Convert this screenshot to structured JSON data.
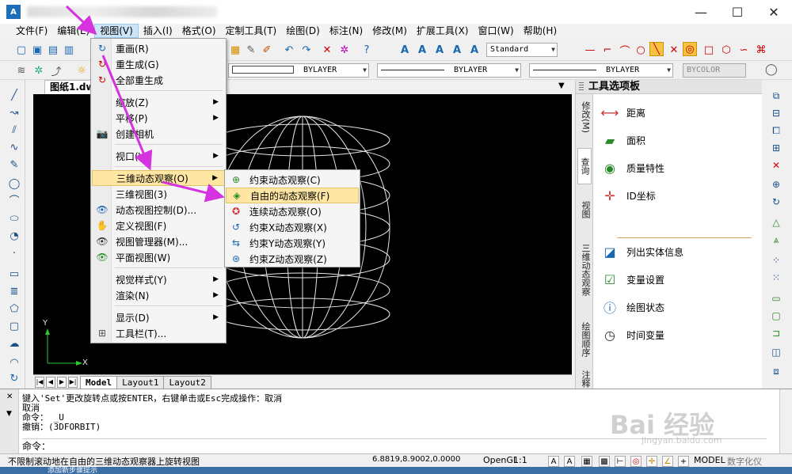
{
  "window": {
    "logo_text": "A",
    "controls": [
      "—",
      "☐",
      "✕"
    ]
  },
  "menubar": [
    {
      "label": "文件(F)"
    },
    {
      "label": "编辑(E)"
    },
    {
      "label": "视图(V)"
    },
    {
      "label": "插入(I)"
    },
    {
      "label": "格式(O)"
    },
    {
      "label": "定制工具(T)"
    },
    {
      "label": "绘图(D)"
    },
    {
      "label": "标注(N)"
    },
    {
      "label": "修改(M)"
    },
    {
      "label": "扩展工具(X)"
    },
    {
      "label": "窗口(W)"
    },
    {
      "label": "帮助(H)"
    }
  ],
  "toolbar": {
    "text_style": "Standard",
    "layer1": "BYLAYER",
    "layer2": "BYLAYER",
    "layer3": "BYLAYER",
    "color": "BYCOLOR"
  },
  "document": {
    "tab": "图纸1.dw",
    "axis_x": "X",
    "axis_y": "Y"
  },
  "layouts": [
    "Model",
    "Layout1",
    "Layout2"
  ],
  "view_menu": {
    "items": [
      {
        "label": "重画(R)",
        "icon": "↻"
      },
      {
        "label": "重生成(G)",
        "icon": "↻"
      },
      {
        "label": "全部重生成",
        "icon": "↻"
      },
      {
        "label": "缩放(Z)"
      },
      {
        "label": "平移(P)"
      },
      {
        "label": "创建相机",
        "icon": "📷"
      },
      {
        "label": "视口(V)"
      },
      {
        "label": "三维动态观察(O)"
      },
      {
        "label": "三维视图(3)"
      },
      {
        "label": "动态视图控制(D)...",
        "icon": "👁"
      },
      {
        "label": "定义视图(F)",
        "icon": "✋"
      },
      {
        "label": "视图管理器(M)...",
        "icon": "👁"
      },
      {
        "label": "平面视图(W)",
        "icon": "👁"
      },
      {
        "label": "视觉样式(Y)"
      },
      {
        "label": "渲染(N)"
      },
      {
        "label": "显示(D)"
      },
      {
        "label": "工具栏(T)...",
        "icon": "⊞"
      }
    ]
  },
  "orbit_submenu": {
    "items": [
      {
        "label": "约束动态观察(C)",
        "icon": "⊕"
      },
      {
        "label": "自由的动态观察(F)",
        "icon": "◈"
      },
      {
        "label": "连续动态观察(O)",
        "icon": "✪"
      },
      {
        "label": "约束X动态观察(X)",
        "icon": "↺"
      },
      {
        "label": "约束Y动态观察(Y)",
        "icon": "⇆"
      },
      {
        "label": "约束Z动态观察(Z)",
        "icon": "⊛"
      }
    ]
  },
  "palette": {
    "title": "工具选项板",
    "tabs": [
      "修改(M)",
      "查询",
      "视图",
      "三维动态观察",
      "绘图顺序",
      "注释"
    ],
    "items": [
      {
        "label": "距离"
      },
      {
        "label": "面积"
      },
      {
        "label": "质量特性"
      },
      {
        "label": "ID坐标"
      },
      {
        "label": "列出实体信息"
      },
      {
        "label": "变量设置"
      },
      {
        "label": "绘图状态"
      },
      {
        "label": "时间变量"
      }
    ]
  },
  "command": {
    "lines": [
      "键入'Set'更改旋转点或按ENTER，右键单击或Esc完成操作：取消",
      "取消",
      "命令：  _U",
      "撤销：(3DFORBIT)"
    ],
    "prompt": "命令："
  },
  "watermark": {
    "main": "Bai 经验",
    "sub": "jingyan.baidu.com"
  },
  "status": {
    "message": "不限制滚动地在自由的三维动态观察器上旋转视图",
    "coords": "6.8819,8.9002,0.0000",
    "opengl": "OpenGL",
    "scale": "1:1",
    "model": "MODEL",
    "digitizer": "数字化仪"
  },
  "taskbar_text": "添加新步骤提示",
  "colors": {
    "menu_highlight": "#ffe7a3",
    "arrow": "#d633e0",
    "canvas": "#000000"
  }
}
